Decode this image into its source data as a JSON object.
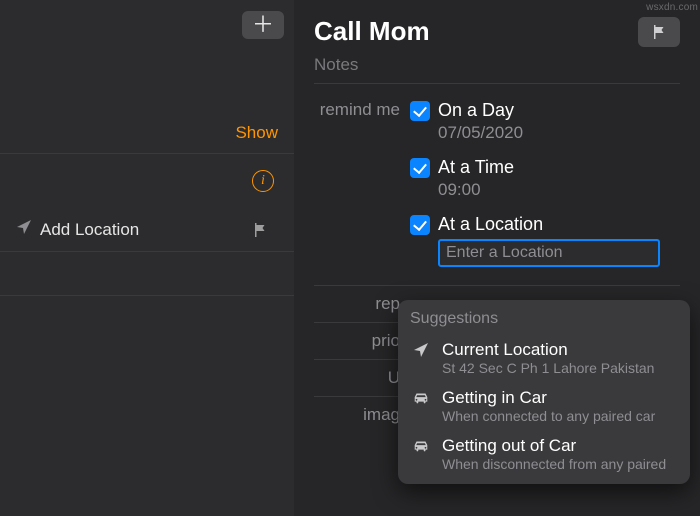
{
  "watermark": "wsxdn.com",
  "sidebar": {
    "show_label": "Show",
    "add_location_label": "Add Location"
  },
  "detail": {
    "title": "Call Mom",
    "notes_placeholder": "Notes",
    "remind_me_label": "remind me",
    "options": {
      "day": {
        "label": "On a Day",
        "value": "07/05/2020"
      },
      "time": {
        "label": "At a Time",
        "value": "09:00"
      },
      "location": {
        "label": "At a Location",
        "placeholder": "Enter a Location"
      }
    },
    "rows": {
      "repeat": "rep",
      "priority": "prio",
      "url": "U",
      "images": "imag"
    }
  },
  "suggestions": {
    "title": "Suggestions",
    "items": [
      {
        "icon": "location-arrow",
        "title": "Current Location",
        "subtitle": "St 42 Sec C Ph 1 Lahore Pakistan"
      },
      {
        "icon": "car",
        "title": "Getting in Car",
        "subtitle": "When connected to any paired car"
      },
      {
        "icon": "car",
        "title": "Getting out of Car",
        "subtitle": "When disconnected from any paired"
      }
    ]
  }
}
